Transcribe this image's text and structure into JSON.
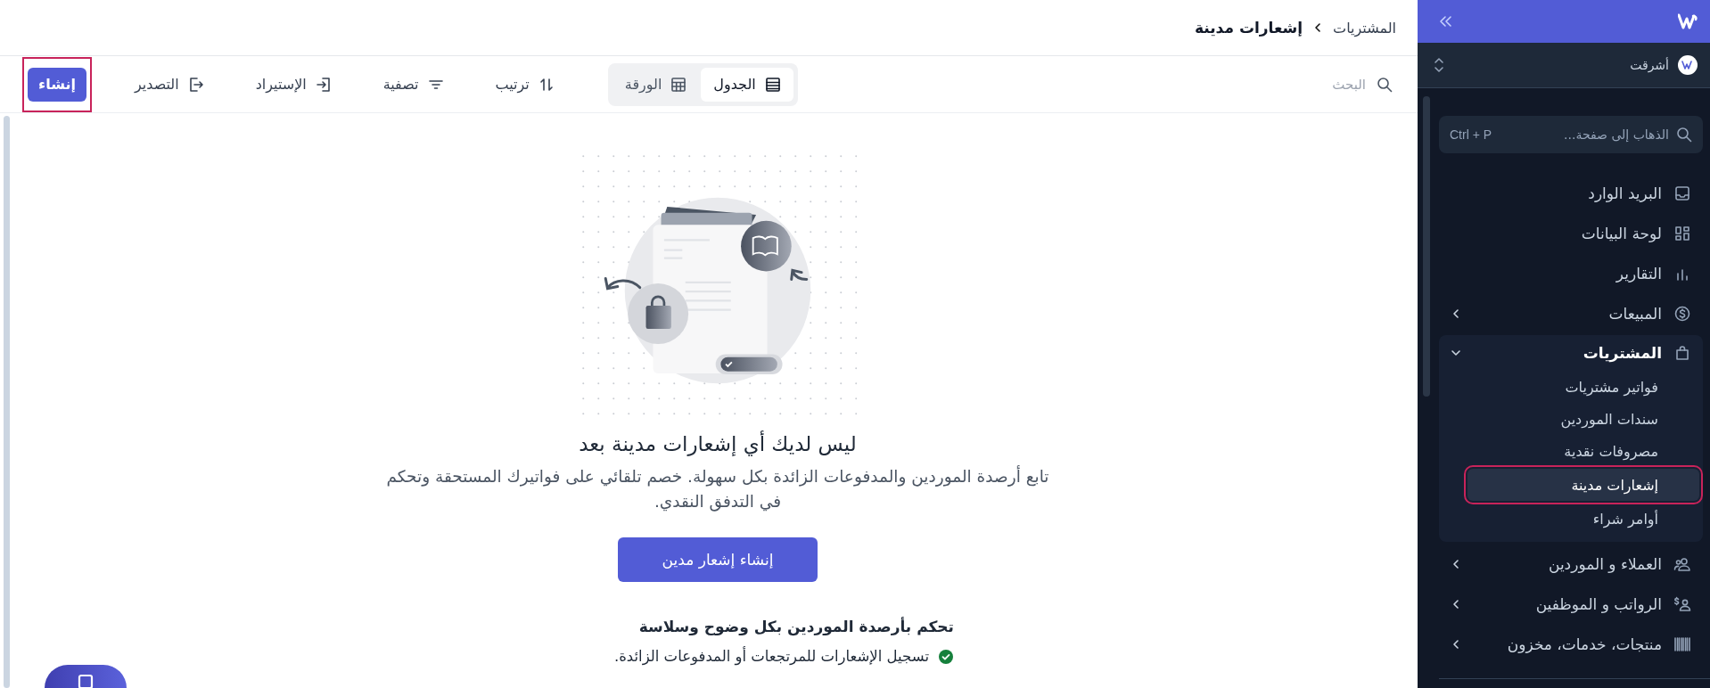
{
  "header": {
    "breadcrumb": [
      {
        "label": "المشتريات"
      },
      {
        "label": "إشعارات مدينة"
      }
    ]
  },
  "toolbar": {
    "search": {
      "placeholder": "البحث"
    },
    "view_toggle": [
      {
        "label": "الجدول",
        "selected": true
      },
      {
        "label": "الورقة",
        "selected": false
      }
    ],
    "actions": [
      {
        "label": "ترتيب"
      },
      {
        "label": "تصفية"
      },
      {
        "label": "الإستيراد"
      },
      {
        "label": "التصدير"
      }
    ],
    "create_button": {
      "label": "إنشاء",
      "highlighted": true
    }
  },
  "empty_state": {
    "title": "ليس لديك أي إشعارات مدينة بعد",
    "description": "تابع أرصدة الموردين والمدفوعات الزائدة بكل سهولة. خصم تلقائي على فواتيرك المستحقة وتحكم في التدفق النقدي.",
    "button": "إنشاء إشعار مدين",
    "features_title": "تحكم بأرصدة الموردين بكل وضوح وسلاسة",
    "features": [
      {
        "text": "تسجيل الإشعارات للمرتجعات أو المدفوعات الزائدة."
      }
    ]
  },
  "sidebar": {
    "organization": {
      "name": "أشرقت"
    },
    "search": {
      "placeholder": "الذهاب إلى صفحة...",
      "shortcut": "Ctrl + P"
    },
    "items": [
      {
        "label": "البريد الوارد"
      },
      {
        "label": "لوحة البيانات"
      },
      {
        "label": "التقارير"
      },
      {
        "label": "المبيعات",
        "expanded": false
      },
      {
        "label": "المشتريات",
        "expanded": true,
        "children": [
          {
            "label": "فواتير مشتريات",
            "selected": false,
            "highlighted": false
          },
          {
            "label": "سندات الموردين",
            "selected": false,
            "highlighted": false
          },
          {
            "label": "مصروفات نقدية",
            "selected": false,
            "highlighted": false
          },
          {
            "label": "إشعارات مدينة",
            "selected": true,
            "highlighted": true
          },
          {
            "label": "أوامر شراء",
            "selected": false,
            "highlighted": false
          }
        ]
      },
      {
        "label": "العملاء و الموردين",
        "expanded": false
      },
      {
        "label": "الرواتب و الموظفين",
        "expanded": false
      },
      {
        "label": "منتجات، خدمات، مخزون",
        "expanded": false
      }
    ]
  }
}
